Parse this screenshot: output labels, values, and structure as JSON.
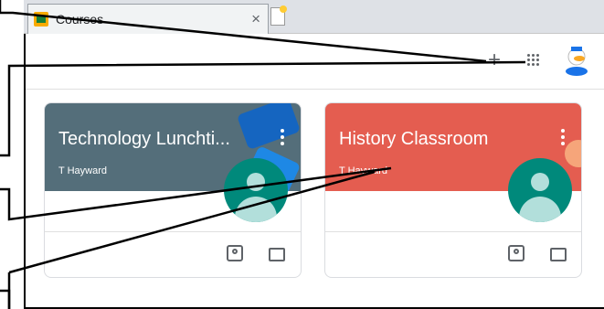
{
  "tab": {
    "title": "Courses",
    "close": "×"
  },
  "appbar": {
    "add": "+"
  },
  "courses": [
    {
      "title": "Technology Lunchti...",
      "owner": "T Hayward",
      "color": "#546e7a"
    },
    {
      "title": "History Classroom",
      "owner": "T Hayward",
      "color": "#e45d50"
    }
  ]
}
